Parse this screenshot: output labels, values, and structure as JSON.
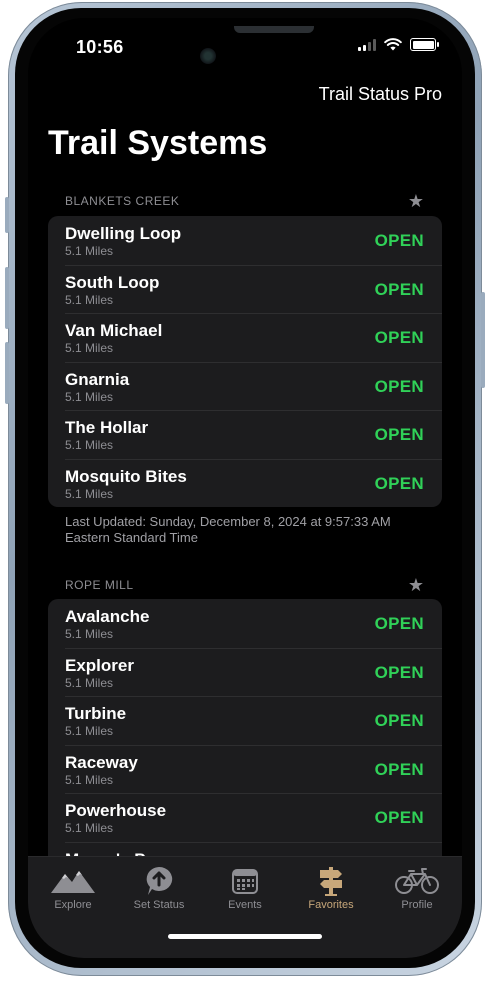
{
  "status_bar": {
    "time": "10:56"
  },
  "header": {
    "app_title": "Trail Status Pro",
    "page_title": "Trail Systems"
  },
  "sections": [
    {
      "name": "BLANKETS CREEK",
      "trails": [
        {
          "name": "Dwelling Loop",
          "distance": "5.1 Miles",
          "status": "OPEN"
        },
        {
          "name": "South Loop",
          "distance": "5.1 Miles",
          "status": "OPEN"
        },
        {
          "name": "Van Michael",
          "distance": "5.1 Miles",
          "status": "OPEN"
        },
        {
          "name": "Gnarnia",
          "distance": "5.1 Miles",
          "status": "OPEN"
        },
        {
          "name": "The Hollar",
          "distance": "5.1 Miles",
          "status": "OPEN"
        },
        {
          "name": "Mosquito Bites",
          "distance": "5.1 Miles",
          "status": "OPEN"
        }
      ],
      "last_updated_line1": "Last Updated: Sunday, December 8, 2024 at 9:57:33 AM",
      "last_updated_line2": "Eastern Standard Time"
    },
    {
      "name": "ROPE MILL",
      "trails": [
        {
          "name": "Avalanche",
          "distance": "5.1 Miles",
          "status": "OPEN"
        },
        {
          "name": "Explorer",
          "distance": "5.1 Miles",
          "status": "OPEN"
        },
        {
          "name": "Turbine",
          "distance": "5.1 Miles",
          "status": "OPEN"
        },
        {
          "name": "Raceway",
          "distance": "5.1 Miles",
          "status": "OPEN"
        },
        {
          "name": "Powerhouse",
          "distance": "5.1 Miles",
          "status": "OPEN"
        },
        {
          "name": "Moore's Pass",
          "distance": "",
          "status": ""
        }
      ]
    }
  ],
  "tab_bar": {
    "tabs": [
      {
        "label": "Explore",
        "icon": "mountains-icon"
      },
      {
        "label": "Set Status",
        "icon": "speech-arrow-icon"
      },
      {
        "label": "Events",
        "icon": "calendar-icon"
      },
      {
        "label": "Favorites",
        "icon": "signpost-icon"
      },
      {
        "label": "Profile",
        "icon": "bicycle-icon"
      }
    ],
    "active_index": 3
  },
  "colors": {
    "open": "#30d158",
    "active_tab": "#c7a77a",
    "inactive_tab": "#8e8e93"
  }
}
